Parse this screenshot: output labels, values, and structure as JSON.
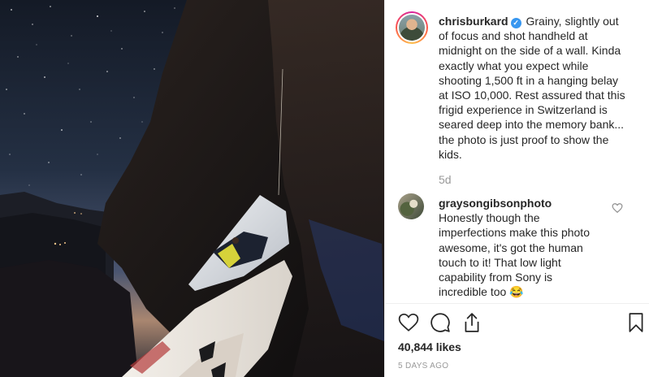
{
  "post": {
    "username": "chrisburkard",
    "verified_mark": "✓",
    "caption": "Grainy, slightly out of focus and shot handheld at midnight on the side of a wall. Kinda exactly what you expect while shooting 1,500 ft in a hanging belay at ISO 10,000. Rest assured that this frigid experience in Switzerland is seared deep into the memory bank... the photo is just proof to show the kids.",
    "caption_time": "5d"
  },
  "comment": {
    "username": "graysongibsonphoto",
    "text": "Honestly though the imperfections make this photo awesome, it's got the human touch to it! That low light capability from Sony is incredible too",
    "emoji": "😂"
  },
  "actions": {
    "like_icon": "heart-icon",
    "comment_icon": "comment-icon",
    "share_icon": "share-icon",
    "save_icon": "bookmark-icon"
  },
  "likes": "40,844 likes",
  "date": "5 DAYS AGO",
  "colors": {
    "verified": "#3897f0",
    "muted_text": "#999999",
    "text": "#262626"
  }
}
